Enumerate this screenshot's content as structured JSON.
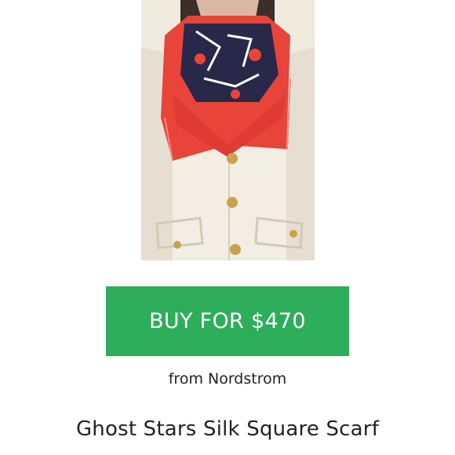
{
  "product": {
    "image_subject": "red-navy-silk-scarf-on-cream-coat",
    "buy_button_label": "BUY FOR $470",
    "retailer_text": "from Nordstrom",
    "title": "Ghost Stars Silk Square Scarf"
  },
  "colors": {
    "button": "#2ead5b",
    "button_text": "#ffffff",
    "text": "#222222",
    "scarf_red": "#e8443a",
    "scarf_navy": "#27284a",
    "coat": "#f1ebdf"
  }
}
